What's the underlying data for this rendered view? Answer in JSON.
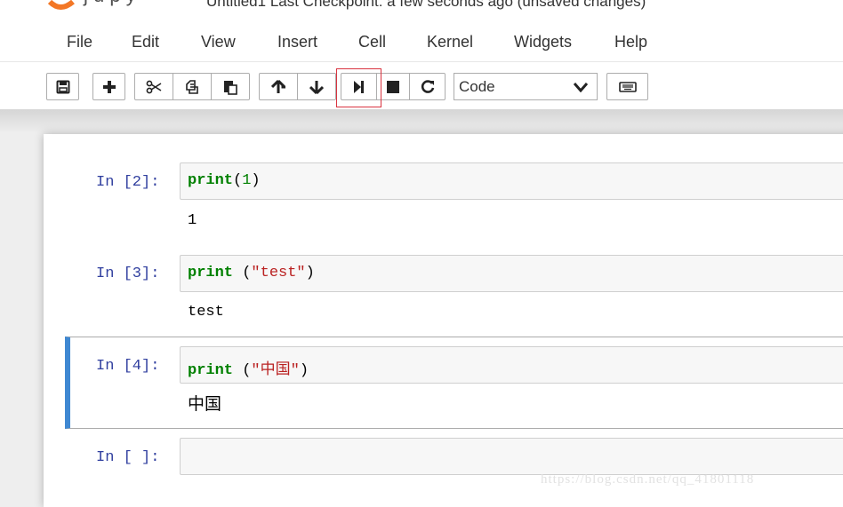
{
  "header": {
    "title": "Untitled1  Last Checkpoint: a few seconds ago  (unsaved changes)"
  },
  "menubar": {
    "items": [
      "File",
      "Edit",
      "View",
      "Insert",
      "Cell",
      "Kernel",
      "Widgets",
      "Help"
    ]
  },
  "toolbar": {
    "buttons": [
      {
        "name": "save-button",
        "icon": "floppy-disk-icon"
      },
      {
        "name": "insert-cell-button",
        "icon": "plus-icon"
      },
      {
        "name": "cut-button",
        "icon": "scissors-icon"
      },
      {
        "name": "copy-button",
        "icon": "copy-icon"
      },
      {
        "name": "paste-button",
        "icon": "paste-icon"
      },
      {
        "name": "move-up-button",
        "icon": "arrow-up-icon"
      },
      {
        "name": "move-down-button",
        "icon": "arrow-down-icon"
      },
      {
        "name": "run-button",
        "icon": "step-forward-icon",
        "highlighted": true
      },
      {
        "name": "interrupt-button",
        "icon": "stop-icon"
      },
      {
        "name": "restart-button",
        "icon": "repeat-icon"
      },
      {
        "name": "command-palette-button",
        "icon": "keyboard-icon"
      }
    ],
    "cell_type": "Code",
    "highlight_color": "#d9333f"
  },
  "cells": [
    {
      "prompt": "In [2]:",
      "code": {
        "keyword": "print",
        "open": "(",
        "arg": "1",
        "close": ")"
      },
      "output": "1"
    },
    {
      "prompt": "In [3]:",
      "code": {
        "keyword": "print",
        "open": " (",
        "arg": "\"test\"",
        "close": ")"
      },
      "output": "test"
    },
    {
      "prompt": "In [4]:",
      "code": {
        "keyword": "print",
        "open": " (",
        "arg": "\"中国\"",
        "close": ")"
      },
      "output": "中国",
      "selected": true
    },
    {
      "prompt": "In [ ]:",
      "code": {
        "keyword": "",
        "open": "",
        "arg": "",
        "close": ""
      },
      "output": ""
    }
  ],
  "colors": {
    "prompt": "#303f9f",
    "keyword": "#008000",
    "string": "#ba2121",
    "selected_bar": "#3f88d2"
  },
  "watermark": "https://blog.csdn.net/qq_41801118"
}
